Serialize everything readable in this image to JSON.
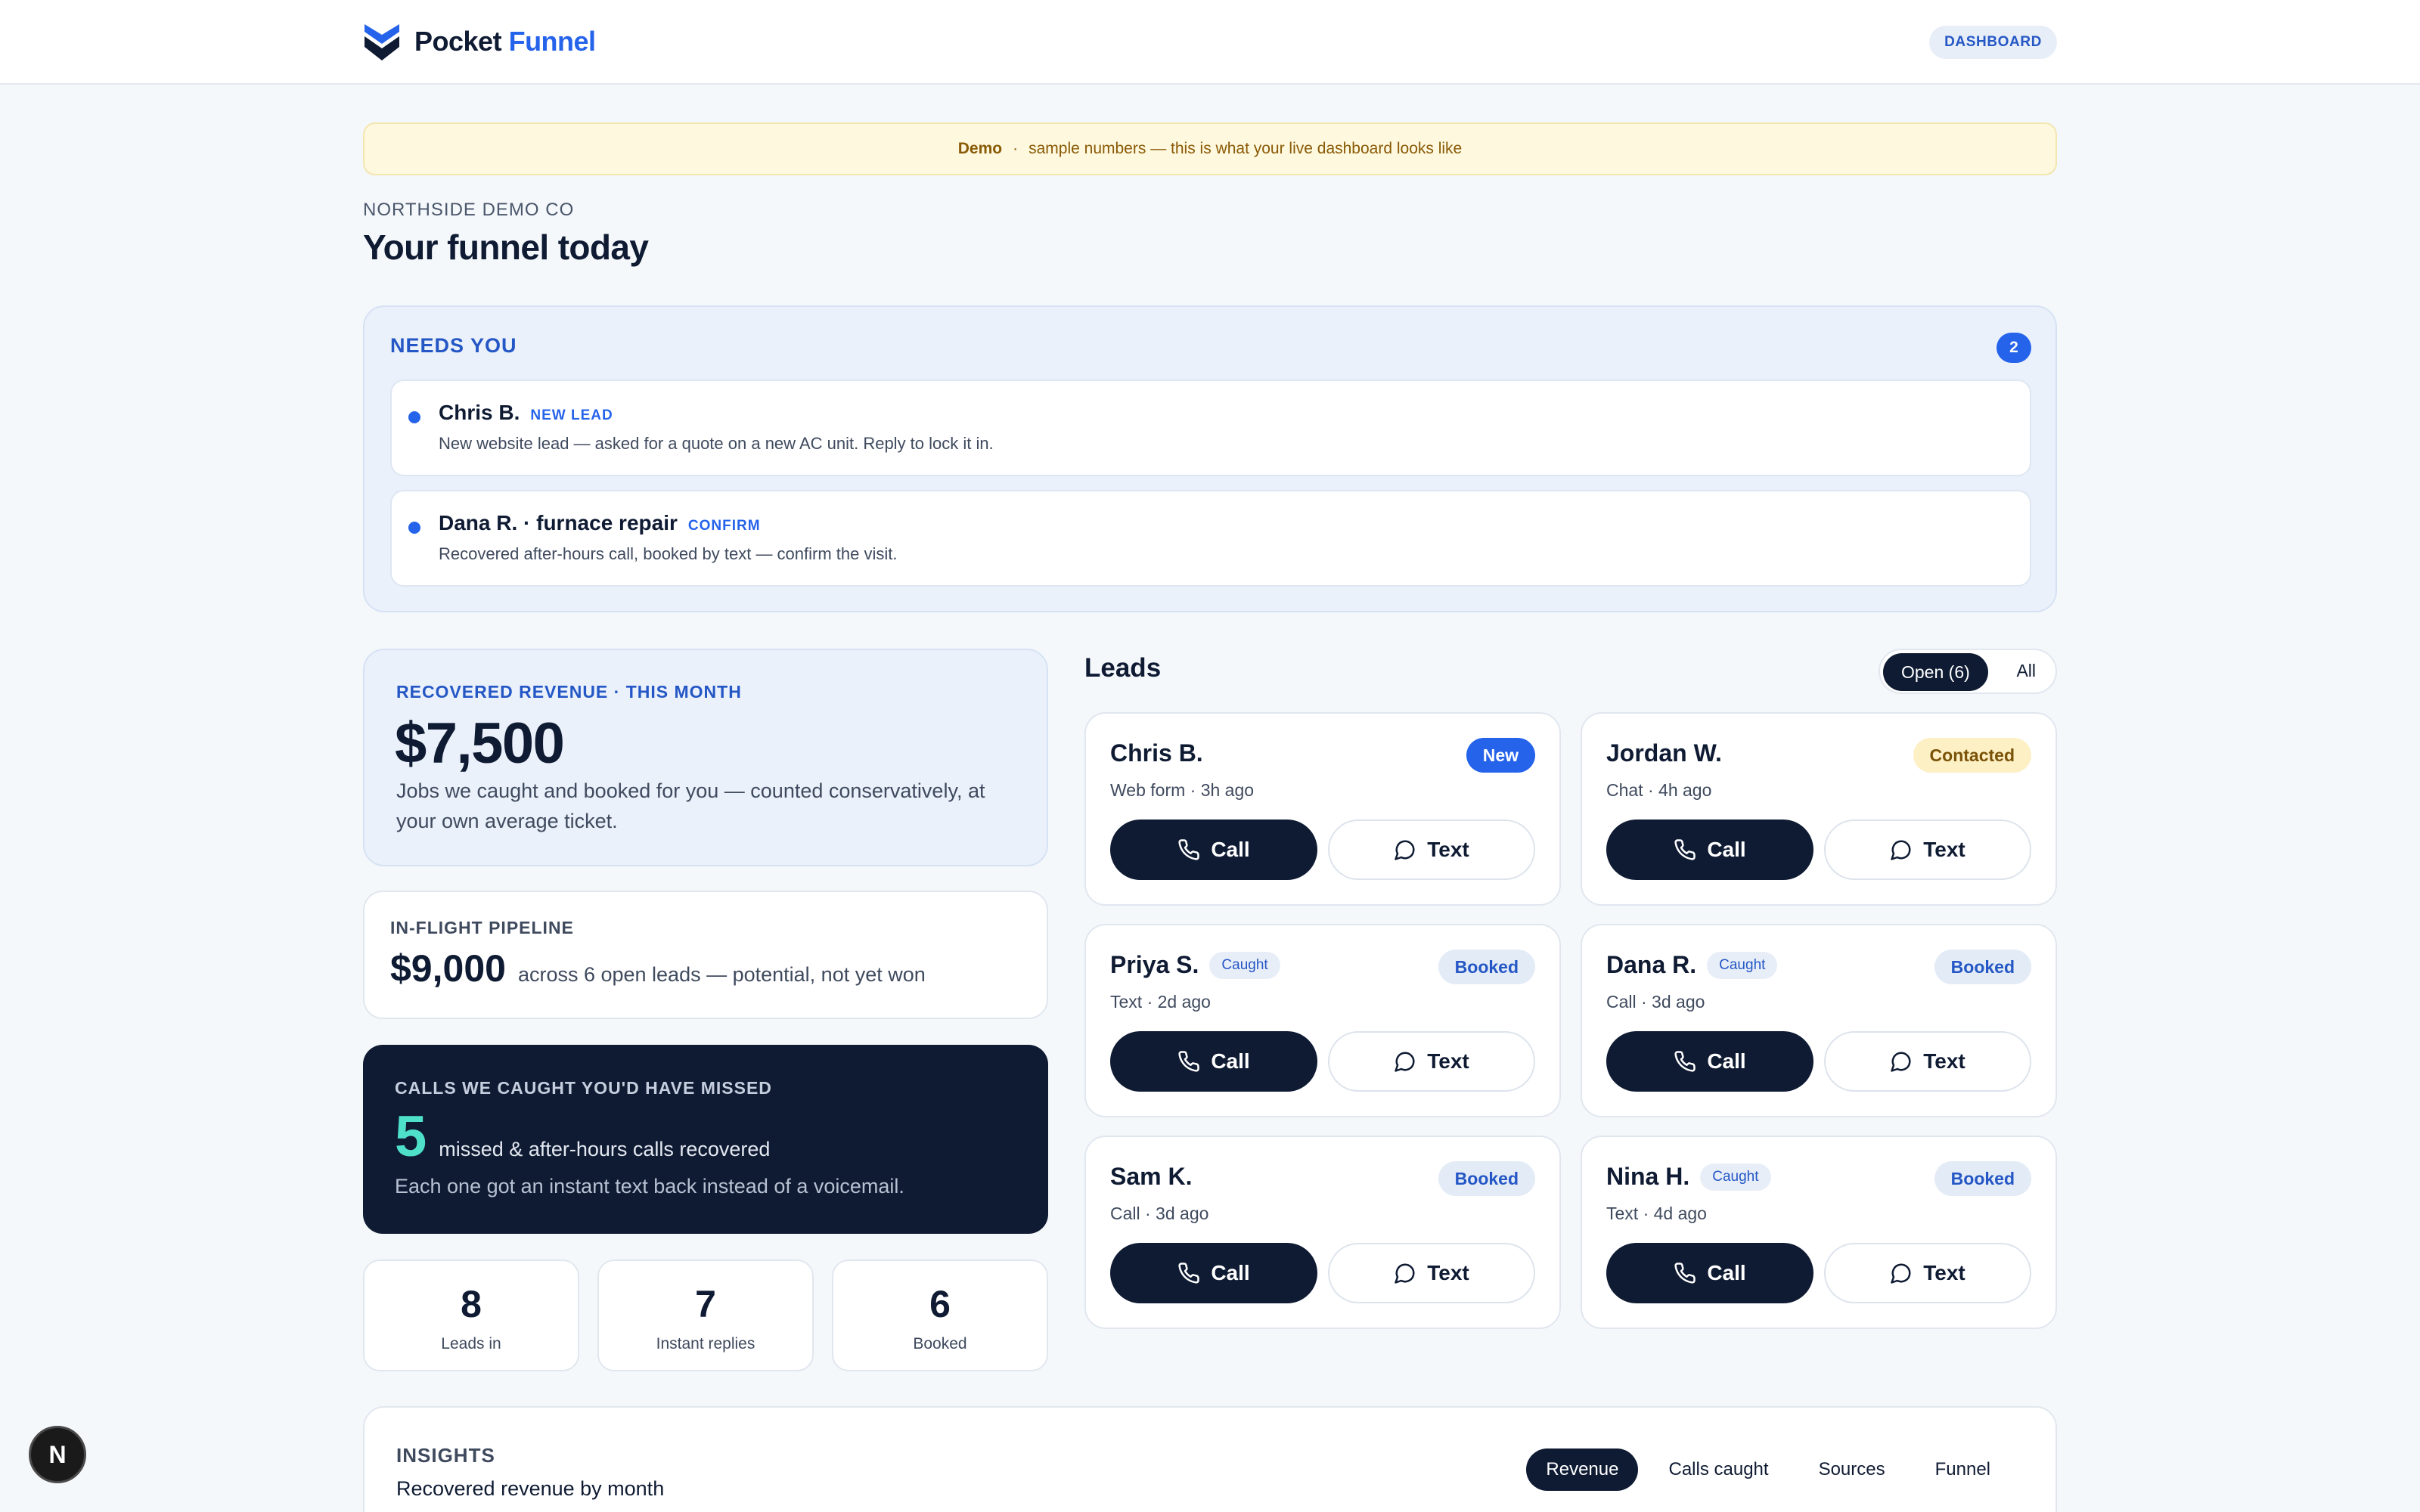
{
  "header": {
    "brand_part1": "Pocket",
    "brand_part2": "Funnel",
    "dashboard_pill": "DASHBOARD"
  },
  "banner": {
    "label": "Demo",
    "separator": "·",
    "message": "sample numbers — this is what your live dashboard looks like"
  },
  "page": {
    "company": "NORTHSIDE DEMO CO",
    "title": "Your funnel today"
  },
  "needs_you": {
    "title": "NEEDS YOU",
    "count": "2",
    "items": [
      {
        "name": "Chris B.",
        "tag": "NEW LEAD",
        "desc": "New website lead — asked for a quote on a new AC unit. Reply to lock it in."
      },
      {
        "name": "Dana R. · furnace repair",
        "tag": "CONFIRM",
        "desc": "Recovered after-hours call, booked by text — confirm the visit."
      }
    ]
  },
  "revenue": {
    "label": "RECOVERED REVENUE · THIS MONTH",
    "amount": "$7,500",
    "desc": "Jobs we caught and booked for you — counted conservatively, at your own average ticket."
  },
  "pipeline": {
    "label": "IN-FLIGHT PIPELINE",
    "amount": "$9,000",
    "desc": "across 6 open leads — potential, not yet won"
  },
  "calls": {
    "label": "CALLS WE CAUGHT YOU'D HAVE MISSED",
    "count": "5",
    "desc": "missed & after-hours calls recovered",
    "sub": "Each one got an instant text back instead of a voicemail."
  },
  "stats": [
    {
      "value": "8",
      "label": "Leads in"
    },
    {
      "value": "7",
      "label": "Instant replies"
    },
    {
      "value": "6",
      "label": "Booked"
    }
  ],
  "leads": {
    "title": "Leads",
    "toggle_open": "Open (6)",
    "toggle_all": "All",
    "call_label": "Call",
    "text_label": "Text",
    "cards": [
      {
        "name": "Chris B.",
        "caught": "",
        "meta": "Web form · 3h ago",
        "status": "New"
      },
      {
        "name": "Jordan W.",
        "caught": "",
        "meta": "Chat · 4h ago",
        "status": "Contacted"
      },
      {
        "name": "Priya S.",
        "caught": "Caught",
        "meta": "Text · 2d ago",
        "status": "Booked"
      },
      {
        "name": "Dana R.",
        "caught": "Caught",
        "meta": "Call · 3d ago",
        "status": "Booked"
      },
      {
        "name": "Sam K.",
        "caught": "",
        "meta": "Call · 3d ago",
        "status": "Booked"
      },
      {
        "name": "Nina H.",
        "caught": "Caught",
        "meta": "Text · 4d ago",
        "status": "Booked"
      }
    ]
  },
  "insights": {
    "label": "INSIGHTS",
    "subtitle": "Recovered revenue by month",
    "tabs": [
      "Revenue",
      "Calls caught",
      "Sources",
      "Funnel"
    ]
  },
  "floating_badge": "N",
  "colors": {
    "accent": "#2563eb",
    "navy": "#0f1b33",
    "teal": "#4ee0c8",
    "banner_bg": "#fdf8de"
  }
}
